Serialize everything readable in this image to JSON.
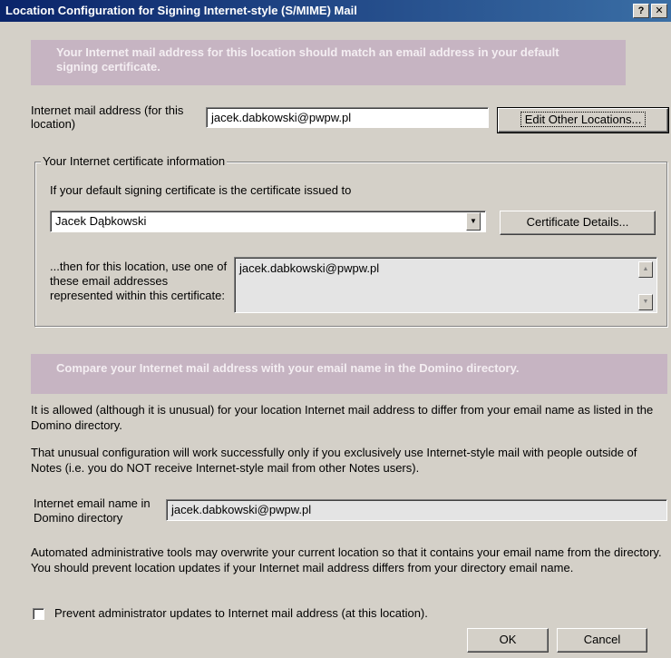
{
  "window": {
    "title": "Location Configuration for Signing Internet-style (S/MIME) Mail",
    "help_label": "?",
    "close_label": "✕"
  },
  "banner1": {
    "text": "Your Internet mail address for this location should match an email address in your default signing certificate."
  },
  "internet_address": {
    "label": "Internet mail address (for this location)",
    "value": "jacek.dabkowski@pwpw.pl",
    "edit_button": "Edit Other Locations..."
  },
  "cert_group": {
    "legend": "Your Internet certificate information",
    "intro": "If your default signing certificate is the certificate issued to",
    "issued_to": "Jacek Dąbkowski",
    "details_button": "Certificate Details...",
    "list_label": "...then for this location, use one of these email addresses represented within this certificate:",
    "addresses": [
      "jacek.dabkowski@pwpw.pl"
    ]
  },
  "banner2": {
    "text": "Compare your Internet mail address with your email name in the Domino directory."
  },
  "para1": "It is allowed (although it is unusual) for your location Internet mail address to differ from your email name as listed in the Domino directory.",
  "para2": "That unusual configuration will work successfully only if you exclusively use Internet-style mail with people outside of Notes (i.e. you do NOT receive Internet-style mail from other Notes users).",
  "domino": {
    "label": "Internet email name in Domino directory",
    "value": "jacek.dabkowski@pwpw.pl"
  },
  "para3": "Automated administrative tools may overwrite your current location so that it contains your email name from the directory.  You should prevent location updates if your Internet mail address differs from your directory email name.",
  "prevent": {
    "label": "Prevent administrator updates to Internet mail address (at this location).",
    "checked": false
  },
  "footer": {
    "ok": "OK",
    "cancel": "Cancel"
  }
}
